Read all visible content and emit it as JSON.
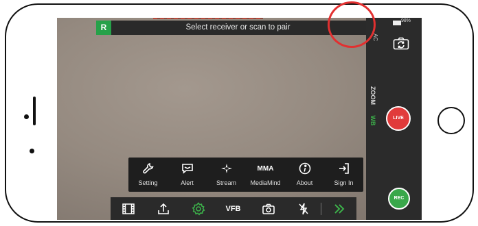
{
  "banner": {
    "logo": "R",
    "message": "Select receiver or scan to pair",
    "scan_icon": "scan-icon"
  },
  "status": {
    "battery": "98%"
  },
  "right_panel": {
    "edge_label": "AC",
    "zoom_label": "ZOOM",
    "wb_label": "WB",
    "live_label": "LIVE",
    "rec_label": "REC"
  },
  "menu": {
    "items": [
      {
        "label": "Setting",
        "icon": "wrench-icon"
      },
      {
        "label": "Alert",
        "icon": "message-icon"
      },
      {
        "label": "Stream",
        "icon": "stream-icon"
      },
      {
        "label": "MediaMind",
        "icon": "text-mma",
        "icon_text": "MMA"
      },
      {
        "label": "About",
        "icon": "info-icon"
      },
      {
        "label": "Sign In",
        "icon": "sign-in-icon"
      }
    ]
  },
  "toolbar": {
    "vfb_label": "VFB"
  },
  "colors": {
    "accent_green": "#39a74a",
    "live_red": "#e13b3b",
    "highlight_red": "#e23030",
    "panel_dark": "#2b2b2b"
  }
}
